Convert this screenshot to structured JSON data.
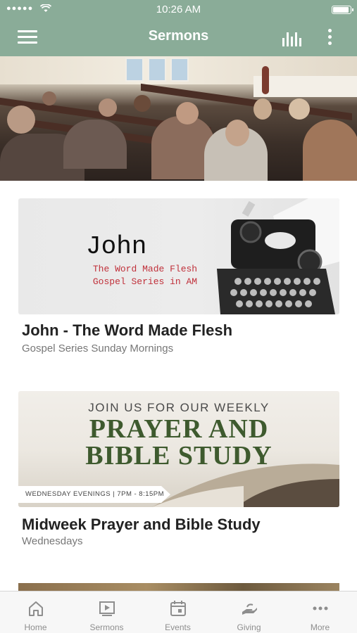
{
  "status_bar": {
    "signal": "●●●●●",
    "time": "10:26 AM"
  },
  "nav": {
    "title": "Sermons"
  },
  "colors": {
    "accent": "#8aac98",
    "tab_inactive": "#8e8e8e",
    "prayer_green": "#3e5a2e",
    "john_red": "#c0303a"
  },
  "sermons": [
    {
      "thumb": {
        "headline": "John",
        "line1": "The Word Made Flesh",
        "line2": "Gospel Series in AM"
      },
      "title": "John - The Word Made Flesh",
      "subtitle": "Gospel Series Sunday Mornings"
    },
    {
      "thumb": {
        "top": "JOIN US FOR OUR WEEKLY",
        "big1": "PRAYER AND",
        "big2": "BIBLE STUDY",
        "ribbon": "WEDNESDAY EVENINGS | 7PM - 8:15PM"
      },
      "title": "Midweek Prayer and Bible Study",
      "subtitle": "Wednesdays"
    }
  ],
  "tabs": [
    {
      "label": "Home",
      "icon": "home-icon"
    },
    {
      "label": "Sermons",
      "icon": "sermons-icon"
    },
    {
      "label": "Events",
      "icon": "calendar-icon"
    },
    {
      "label": "Giving",
      "icon": "giving-icon"
    },
    {
      "label": "More",
      "icon": "more-icon"
    }
  ]
}
